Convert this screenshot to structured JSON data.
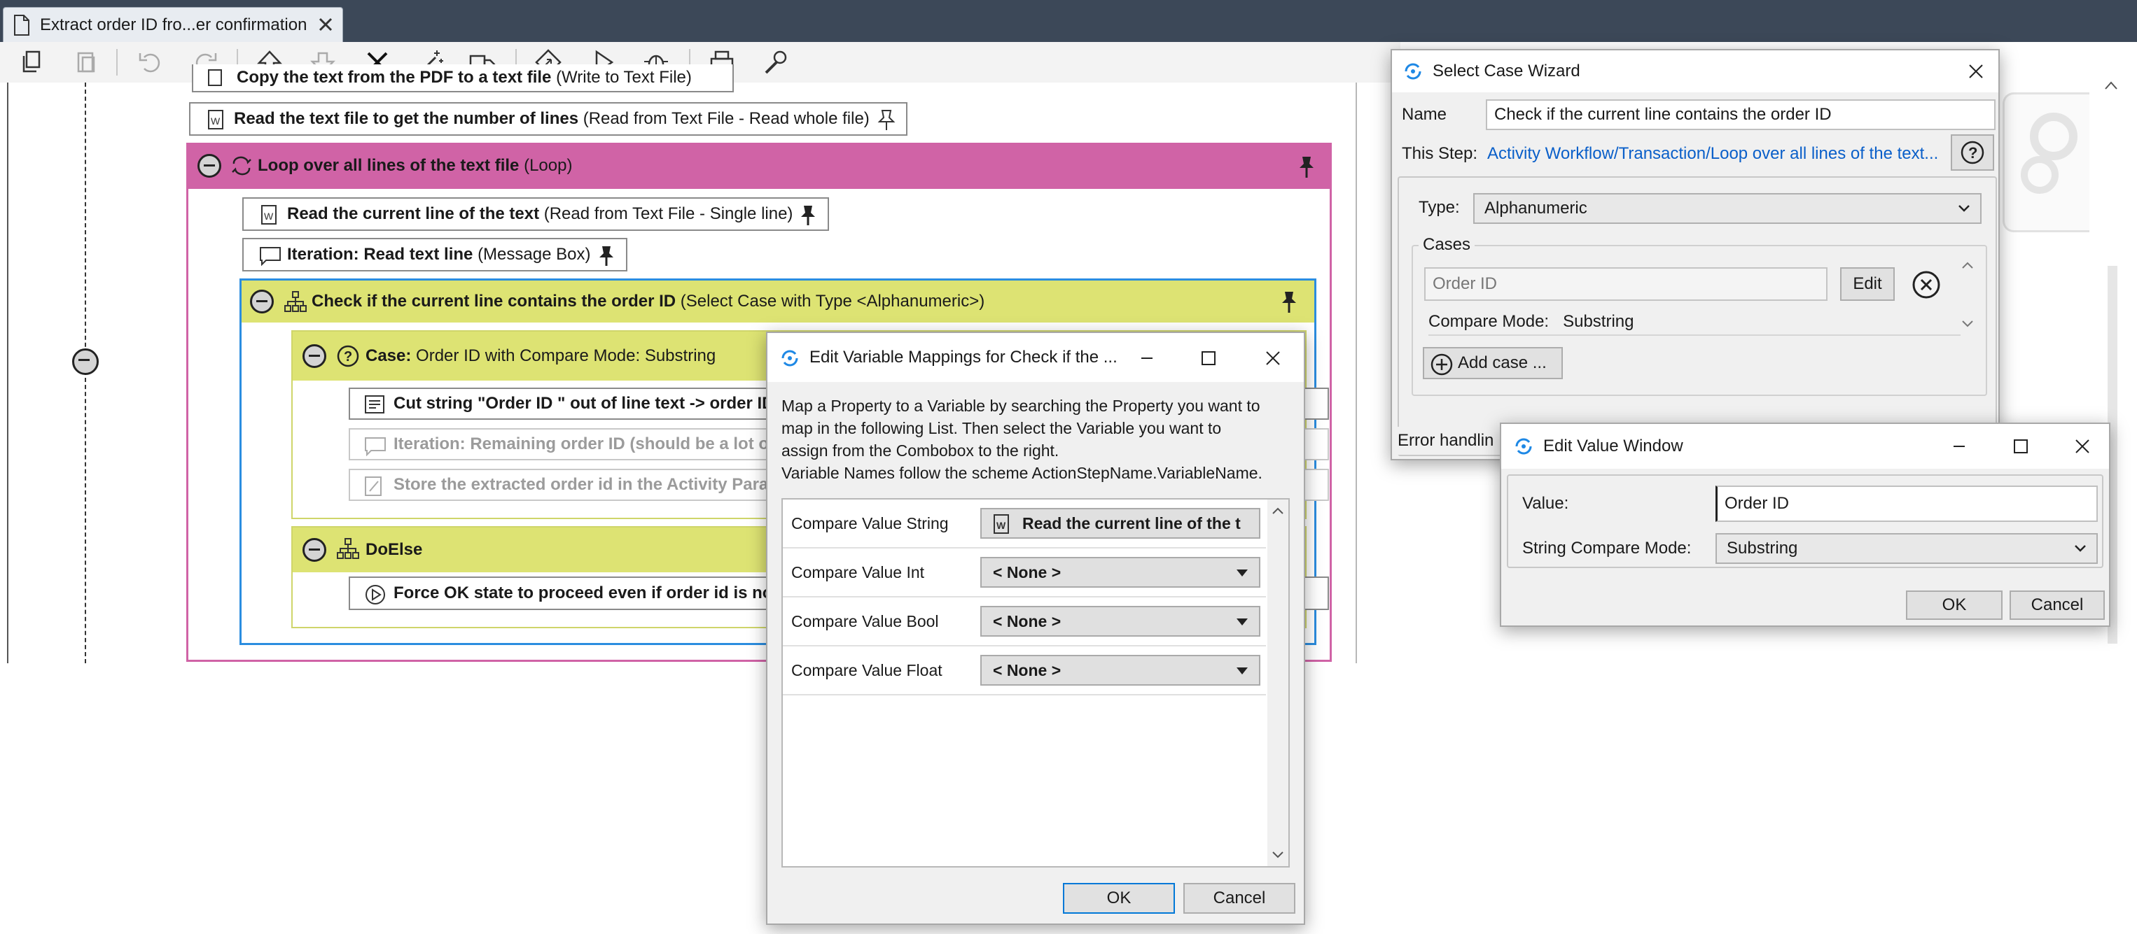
{
  "tab": {
    "title": "Extract order ID fro...er confirmation"
  },
  "toolbar": {
    "buttons": [
      "copy",
      "paste",
      "undo",
      "redo",
      "move-up",
      "move-down",
      "delete",
      "magic-wand",
      "truck",
      "diamond",
      "run",
      "bug",
      "print",
      "settings"
    ]
  },
  "workflow": {
    "step_write_bold": "Copy the text from the PDF to a text file",
    "step_write_type": "(Write to Text File)",
    "step_read_bold": "Read the text file to get the number of lines",
    "step_read_type": "(Read from Text File - Read whole file)",
    "loop_bold": "Loop over all lines of the text file",
    "loop_type": "(Loop)",
    "read_line_bold": "Read the current line of the text",
    "read_line_type": "(Read from Text File - Single line)",
    "iteration_bold": "Iteration: Read text line",
    "iteration_type": "(Message Box)",
    "select_bold": "Check if the current line contains the order ID",
    "select_type": "(Select Case with Type <Alphanumeric>)",
    "case_bold": "Case:",
    "case_text": "Order ID with Compare Mode: Substring",
    "cut_string": "Cut string \"Order ID \" out of line text -> order ID",
    "iteration_remaining": "Iteration: Remaining order ID (should be a lot of...",
    "store_extracted": "Store the extracted order id in the Activity Parameter",
    "doelse": "DoElse",
    "force_ok": "Force OK state to proceed even if order id is not found"
  },
  "mappings_dialog": {
    "title": "Edit Variable Mappings for Check if the ...",
    "description": [
      "Map a Property to a Variable by searching the Property you want to",
      "map in the following List. Then select the Variable you want to",
      "assign from the Combobox to the right.",
      "Variable Names follow the scheme ActionStepName.VariableName."
    ],
    "rows": [
      {
        "label": "Compare Value String",
        "value": "Read the current line of the t"
      },
      {
        "label": "Compare Value Int",
        "value": "< None >"
      },
      {
        "label": "Compare Value Bool",
        "value": "< None >"
      },
      {
        "label": "Compare Value Float",
        "value": "< None >"
      }
    ],
    "ok": "OK",
    "cancel": "Cancel"
  },
  "wizard": {
    "title": "Select Case Wizard",
    "name_label": "Name",
    "name_value": "Check if the current line contains the order ID",
    "this_step_label": "This Step:",
    "this_step_link": "Activity Workflow/Transaction/Loop over all lines of the text...",
    "type_label": "Type:",
    "type_value": "Alphanumeric",
    "cases_label": "Cases",
    "case_field": "Order ID",
    "edit_button": "Edit",
    "compare_mode_label": "Compare Mode:",
    "compare_mode_value": "Substring",
    "add_case": "Add case ...",
    "error_handling": "Error handlin"
  },
  "value_window": {
    "title": "Edit Value Window",
    "value_label": "Value:",
    "value": "Order ID",
    "mode_label": "String Compare Mode:",
    "mode_value": "Substring",
    "ok": "OK",
    "cancel": "Cancel"
  },
  "colors": {
    "loop": "#d063a6",
    "select": "#dde373",
    "select_border": "#2b8de0",
    "link": "#0a5fc9",
    "tabbar": "#3c4858"
  }
}
